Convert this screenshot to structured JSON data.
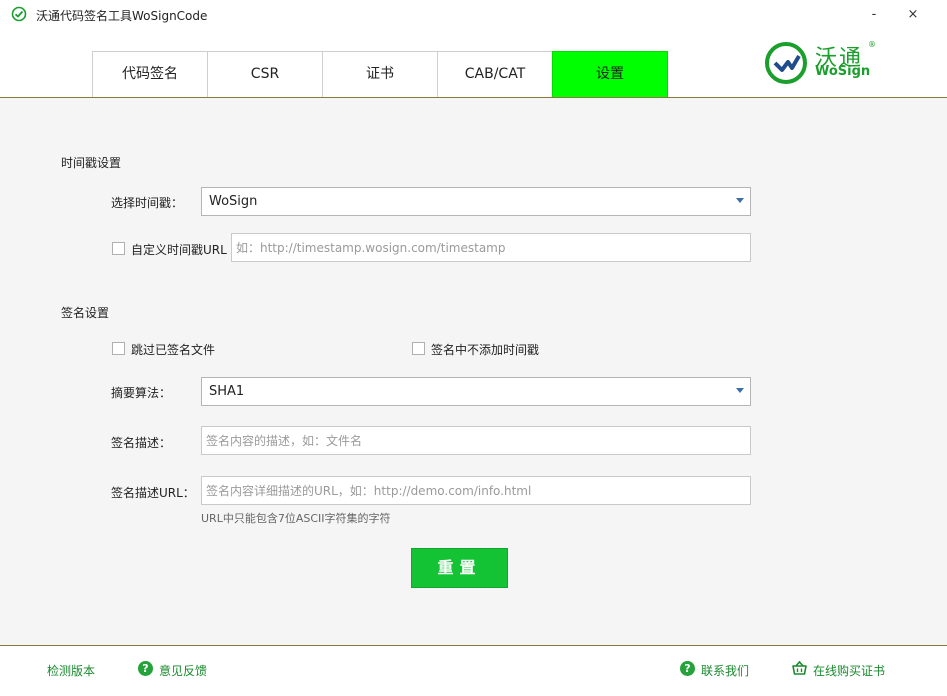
{
  "window": {
    "title": "沃通代码签名工具WoSignCode",
    "minimize_glyph": "-",
    "close_glyph": "×",
    "icon": "checkmark-circle-icon"
  },
  "logo": {
    "cn": "沃通",
    "en": "WoSign",
    "reg": "®"
  },
  "tabs": [
    {
      "label": "代码签名",
      "active": false
    },
    {
      "label": "CSR",
      "active": false
    },
    {
      "label": "证书",
      "active": false
    },
    {
      "label": "CAB/CAT",
      "active": false
    },
    {
      "label": "设置",
      "active": true
    }
  ],
  "timestamp_section": {
    "title": "时间戳设置",
    "select_label": "选择时间戳：",
    "select_value": "WoSign",
    "custom_url_label": "自定义时间戳URL",
    "custom_url_checked": false,
    "custom_url_placeholder": "如：http://timestamp.wosign.com/timestamp"
  },
  "sign_section": {
    "title": "签名设置",
    "skip_signed_label": "跳过已签名文件",
    "skip_signed_checked": false,
    "no_timestamp_label": "签名中不添加时间戳",
    "no_timestamp_checked": false,
    "digest_label": "摘要算法：",
    "digest_value": "SHA1",
    "desc_label": "签名描述：",
    "desc_placeholder": "签名内容的描述，如：文件名",
    "desc_url_label": "签名描述URL：",
    "desc_url_placeholder": "签名内容详细描述的URL，如：http://demo.com/info.html",
    "url_hint": "URL中只能包含7位ASCII字符集的字符"
  },
  "reset_label": "重置",
  "footer": {
    "check_version": "检测版本",
    "feedback": "意见反馈",
    "contact": "联系我们",
    "buy": "在线购买证书"
  },
  "colors": {
    "active_tab": "#00ff00",
    "reset_button": "#14c334",
    "brand_green": "#1a9e2c",
    "footer_link": "#1a8a2e"
  }
}
